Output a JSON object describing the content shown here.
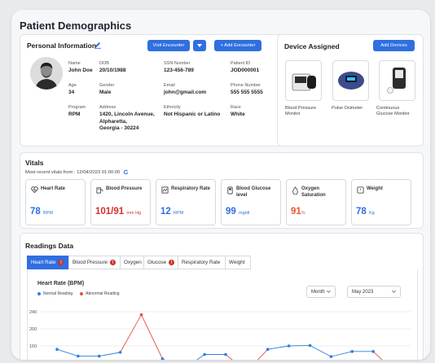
{
  "page_title": "Patient Demographics",
  "personal": {
    "title": "Personal Information",
    "visit_button": "Visit Encounter",
    "add_encounter_button": "+ Add Encounter",
    "fields": {
      "name": {
        "label": "Name",
        "value": "John Doe"
      },
      "dob": {
        "label": "DOB",
        "value": "20/10/1988"
      },
      "ssn": {
        "label": "SSN Number",
        "value": "123-456-789"
      },
      "patient_id": {
        "label": "Patient ID",
        "value": "JOD000001"
      },
      "age": {
        "label": "Age",
        "value": "34"
      },
      "gender": {
        "label": "Gender",
        "value": "Male"
      },
      "email": {
        "label": "Email",
        "value": "john@gmail.com"
      },
      "phone": {
        "label": "Phone Number",
        "value": "555 555 5555"
      },
      "program": {
        "label": "Program",
        "value": "RPM"
      },
      "address": {
        "label": "Address",
        "value_line1": "1420, Lincoln Avenue,",
        "value_line2": "Alpharetta,",
        "value_line3": "Georgia - 30224"
      },
      "ethnicity": {
        "label": "Ethnicity",
        "value": "Not Hispanic or Latino"
      },
      "race": {
        "label": "Race",
        "value": "White"
      }
    }
  },
  "devices": {
    "title": "Device Assigned",
    "add_button": "Add Devices",
    "items": [
      {
        "line1": "Blood Pressure",
        "line2": "Monitor",
        "icon": "bp-monitor-icon"
      },
      {
        "line1": "Pulse Oximeter",
        "line2": "",
        "icon": "pulse-oximeter-icon"
      },
      {
        "line1": "Continuous",
        "line2": "Glucose Monitor",
        "icon": "glucose-monitor-icon"
      }
    ]
  },
  "vitals": {
    "title": "Vitals",
    "subtitle": "Most recent vitals from : 12/04/2023 01:00:00",
    "items": [
      {
        "label": "Heart Rate",
        "label2": "",
        "value": "78",
        "unit": "BPM",
        "color": "#2f6fe0",
        "icon": "heart-rate-icon"
      },
      {
        "label": "Blood Pressure",
        "label2": "",
        "value": "101/91",
        "unit": "mm Hg",
        "color": "#d0312d",
        "icon": "blood-pressure-icon"
      },
      {
        "label": "Respiratory Rate",
        "label2": "",
        "value": "12",
        "unit": "RPM",
        "color": "#2f6fe0",
        "icon": "respiratory-icon"
      },
      {
        "label": "Blood Glucose",
        "label2": "level",
        "value": "99",
        "unit": "mg/dl",
        "color": "#2f6fe0",
        "icon": "glucose-icon"
      },
      {
        "label": "Oxygen",
        "label2": "Saturation",
        "value": "91",
        "unit": "%",
        "color": "#e5562f",
        "icon": "oxygen-icon"
      },
      {
        "label": "Weight",
        "label2": "",
        "value": "78",
        "unit": "Kg",
        "color": "#2f6fe0",
        "icon": "weight-icon"
      }
    ]
  },
  "readings": {
    "title": "Readings Data",
    "tabs": [
      {
        "label": "Heart Rate",
        "alert": "!"
      },
      {
        "label": "Blood Pressure",
        "alert": "!"
      },
      {
        "label": "Oxygen",
        "alert": ""
      },
      {
        "label": "Glucose",
        "alert": "!"
      },
      {
        "label": "Respiratory Rate",
        "alert": ""
      },
      {
        "label": "Weight",
        "alert": ""
      }
    ],
    "period_select": "Month",
    "month_select": "May 2023"
  },
  "chart_data": {
    "type": "line",
    "title": "Heart Rate (BPM)",
    "legend": [
      "Normal Reading",
      "Abnormal Reading"
    ],
    "colors": {
      "normal": "#2f7fe0",
      "abnormal": "#e5503f"
    },
    "ylim": [
      120,
      240
    ],
    "yticks": [
      240,
      200,
      160,
      120
    ],
    "points": [
      {
        "y": 152,
        "abnormal": false
      },
      {
        "y": 136,
        "abnormal": false
      },
      {
        "y": 136,
        "abnormal": false
      },
      {
        "y": 145,
        "abnormal": false
      },
      {
        "y": 233,
        "abnormal": true
      },
      {
        "y": 130,
        "abnormal": false
      },
      {
        "y": 105,
        "abnormal": false
      },
      {
        "y": 140,
        "abnormal": false
      },
      {
        "y": 140,
        "abnormal": false
      },
      {
        "y": 100,
        "abnormal": true
      },
      {
        "y": 152,
        "abnormal": false
      },
      {
        "y": 160,
        "abnormal": false
      },
      {
        "y": 161,
        "abnormal": false
      },
      {
        "y": 135,
        "abnormal": false
      },
      {
        "y": 147,
        "abnormal": false
      },
      {
        "y": 147,
        "abnormal": false
      },
      {
        "y": 100,
        "abnormal": true
      }
    ]
  }
}
